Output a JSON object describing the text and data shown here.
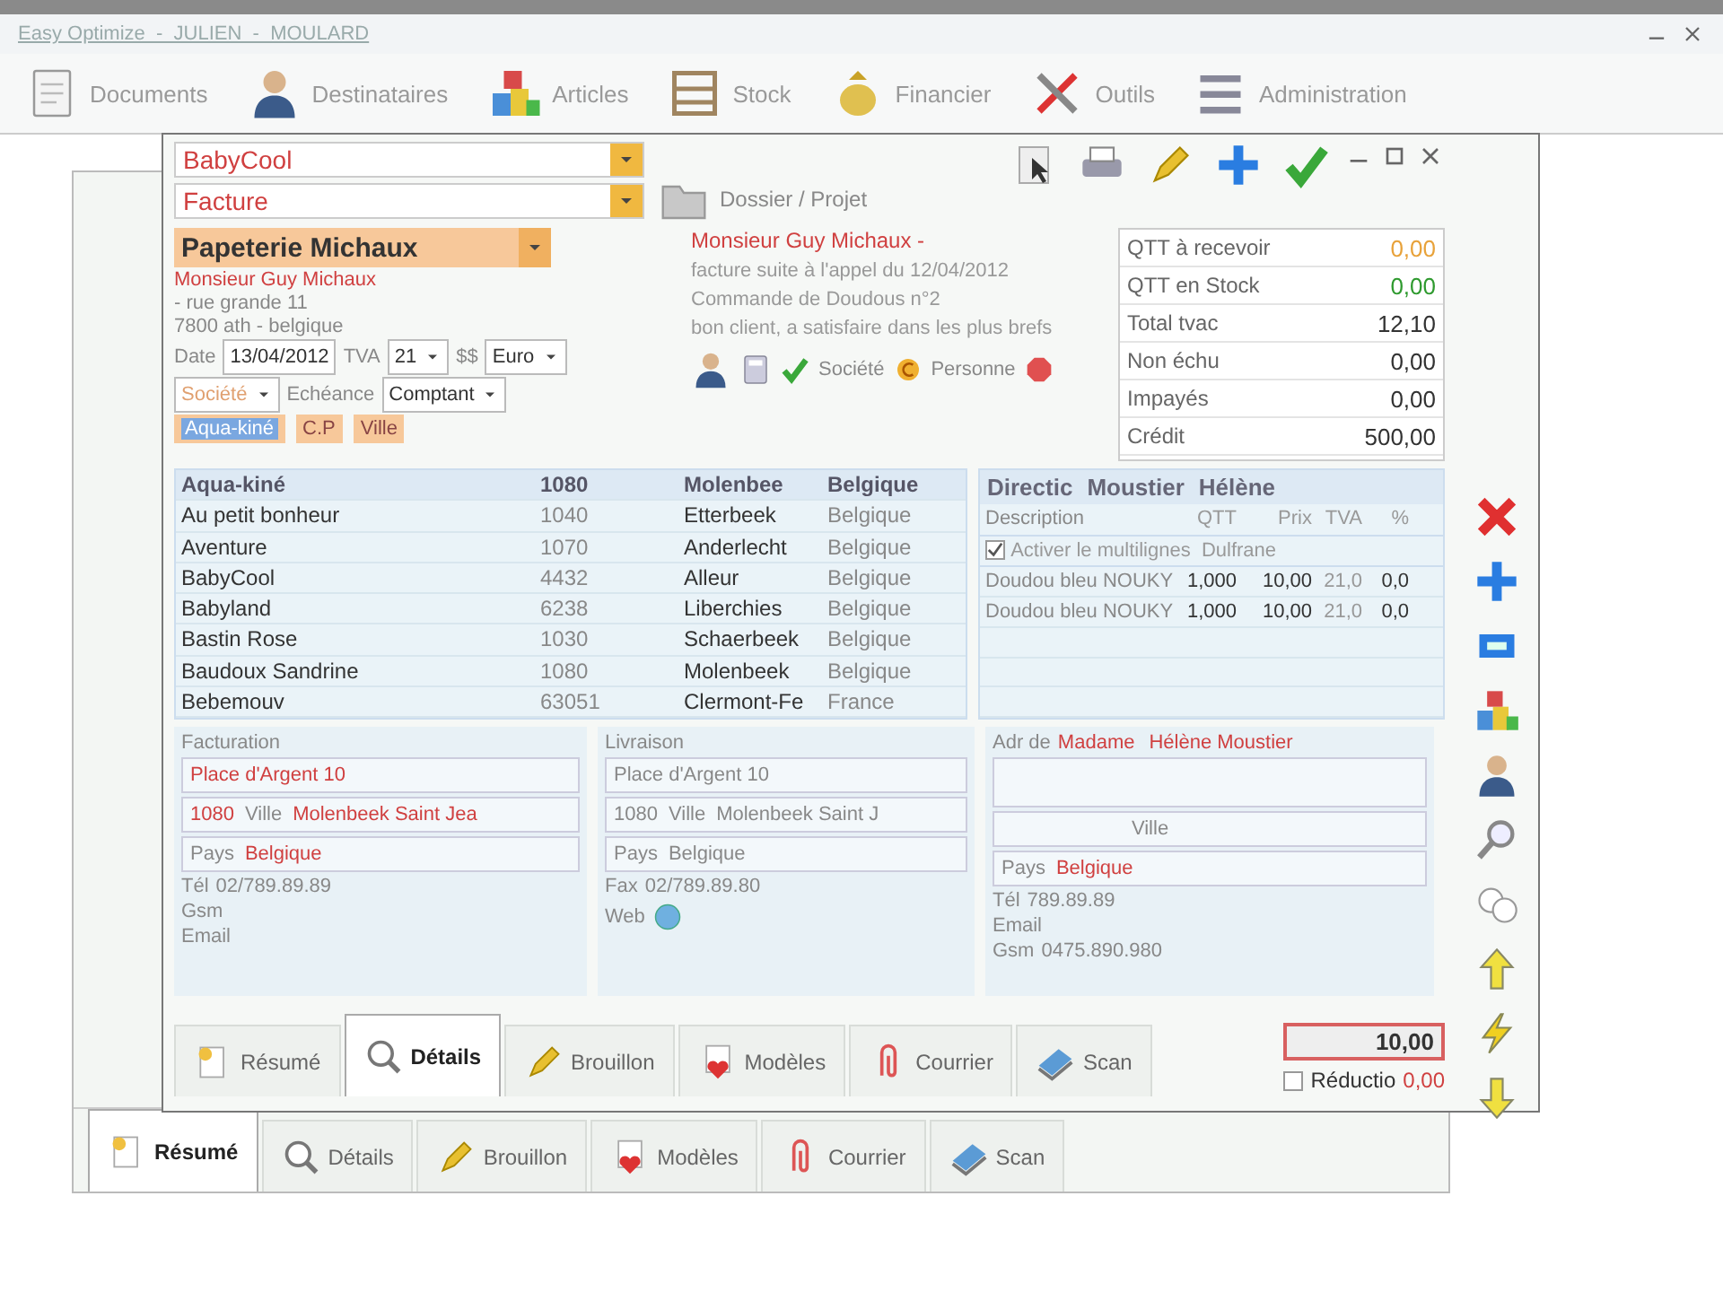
{
  "app": {
    "title": "Easy Optimize  -  JULIEN  -  MOULARD",
    "menu": [
      "Documents",
      "Destinataires",
      "Articles",
      "Stock",
      "Financier",
      "Outils",
      "Administration"
    ]
  },
  "back_window": {
    "tabs": [
      {
        "label": "Résumé",
        "selected": true
      },
      {
        "label": "Détails",
        "selected": false
      },
      {
        "label": "Brouillon",
        "selected": false
      },
      {
        "label": "Modèles",
        "selected": false
      },
      {
        "label": "Courrier",
        "selected": false
      },
      {
        "label": "Scan",
        "selected": false
      }
    ]
  },
  "document": {
    "company": "BabyCool",
    "doc_type": "Facture",
    "folder": "Dossier / Projet",
    "customer": {
      "name": "Papeterie Michaux",
      "contact": "Monsieur Guy Michaux",
      "street": "- rue grande 11",
      "city": "7800 ath - belgique",
      "contact_link": "Monsieur Guy Michaux -"
    },
    "fields": {
      "date_label": "Date",
      "date": "13/04/2012",
      "tva_label": "TVA",
      "tva": "21",
      "currency_label": "$$",
      "currency": "Euro",
      "terms_label": "Echéance",
      "terms": "Comptant"
    },
    "note": "facture suite à l'appel du 12/04/2012",
    "reference": "Commande de Doudous n°2",
    "comment": "bon client, a satisfaire dans les plus brefs",
    "filters": {
      "company": "Société",
      "cp": "C.P",
      "city": "Ville",
      "search": "Aqua-kiné"
    },
    "contact_tabs": [
      "Société",
      "Personne"
    ],
    "summary": [
      {
        "label": "QTT à recevoir",
        "value": "0,00",
        "color": "#e8a23a"
      },
      {
        "label": "QTT en Stock",
        "value": "0,00",
        "color": "#2f9a2f"
      },
      {
        "label": "Total tvac",
        "value": "12,10",
        "color": "#333333"
      },
      {
        "label": "Non échu",
        "value": "0,00",
        "color": "#333333"
      },
      {
        "label": "Impayés",
        "value": "0,00",
        "color": "#333333"
      },
      {
        "label": "Crédit",
        "value": "500,00",
        "color": "#333333"
      }
    ],
    "customers": [
      {
        "name": "Aqua-kiné",
        "cp": "1080",
        "city": "Molenbee",
        "country": "Belgique",
        "selected": true
      },
      {
        "name": "Au petit bonheur",
        "cp": "1040",
        "city": "Etterbeek",
        "country": "Belgique",
        "selected": false
      },
      {
        "name": "Aventure",
        "cp": "1070",
        "city": "Anderlecht",
        "country": "Belgique",
        "selected": false
      },
      {
        "name": "BabyCool",
        "cp": "4432",
        "city": "Alleur",
        "country": "Belgique",
        "selected": false
      },
      {
        "name": "Babyland",
        "cp": "6238",
        "city": "Liberchies",
        "country": "Belgique",
        "selected": false
      },
      {
        "name": "Bastin Rose",
        "cp": "1030",
        "city": "Schaerbeek",
        "country": "Belgique",
        "selected": false
      },
      {
        "name": "Baudoux Sandrine",
        "cp": "1080",
        "city": "Molenbeek",
        "country": "Belgique",
        "selected": false
      },
      {
        "name": "Bebemouv",
        "cp": "63051",
        "city": "Clermont-Fe",
        "country": "France",
        "selected": false
      }
    ],
    "selected_contact": {
      "function": "Directic",
      "last_name": "Moustier",
      "first_name": "Hélène"
    },
    "lines": {
      "headers": [
        "Description",
        "QTT",
        "Prix",
        "TVA",
        "%"
      ],
      "multiline_label": "Activer le multilignes",
      "multiline": true,
      "supplier": "Dulfrane",
      "rows": [
        {
          "description": "Doudou bleu NOUKY",
          "qtt": "1,000",
          "price": "10,00",
          "tva": "21,0",
          "discount": "0,0"
        },
        {
          "description": "Doudou bleu NOUKY",
          "qtt": "1,000",
          "price": "10,00",
          "tva": "21,0",
          "discount": "0,0"
        }
      ]
    },
    "billing": {
      "title": "Facturation",
      "street": "Place d'Argent 10",
      "cp": "1080",
      "city_label": "Ville",
      "city": "Molenbeek Saint Jea",
      "country_label": "Pays",
      "country": "Belgique",
      "phone_label": "Tél",
      "phone": "02/789.89.89",
      "gsm_label": "Gsm",
      "email_label": "Email"
    },
    "delivery": {
      "title": "Livraison",
      "street": "Place d'Argent 10",
      "cp": "1080",
      "city_label": "Ville",
      "city": "Molenbeek Saint J",
      "country_label": "Pays",
      "country": "Belgique",
      "fax_label": "Fax",
      "fax": "02/789.89.80",
      "web_label": "Web"
    },
    "contact": {
      "title": "Adr de",
      "civility": "Madame",
      "name": "Hélène Moustier",
      "city_label": "Ville",
      "country_label": "Pays",
      "country": "Belgique",
      "phone_label": "Tél",
      "phone": "789.89.89",
      "email_label": "Email",
      "gsm_label": "Gsm",
      "gsm": "0475.890.980"
    },
    "tabs": [
      {
        "label": "Résumé",
        "selected": false
      },
      {
        "label": "Détails",
        "selected": true
      },
      {
        "label": "Brouillon",
        "selected": false
      },
      {
        "label": "Modèles",
        "selected": false
      },
      {
        "label": "Courrier",
        "selected": false
      },
      {
        "label": "Scan",
        "selected": false
      }
    ],
    "totals": {
      "total": "10,00",
      "discount_label": "Réductio",
      "discount_checked": false,
      "balance": "0,00"
    }
  }
}
